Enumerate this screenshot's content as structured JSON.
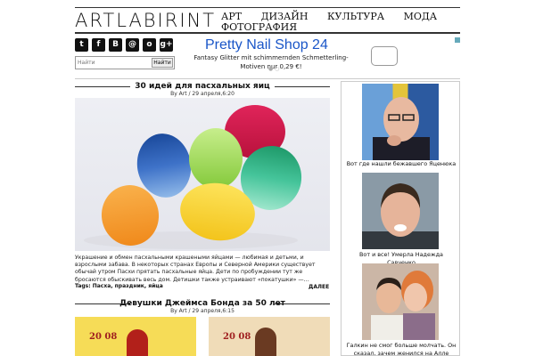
{
  "header": {
    "logo": "ARTLABIRINT"
  },
  "nav": [
    "АРТ",
    "ДИЗАЙН",
    "КУЛЬТУРА",
    "МОДА",
    "ФОТОГРАФИЯ"
  ],
  "social": [
    "twitter-icon",
    "facebook-icon",
    "vk-icon",
    "mail-icon",
    "odnoklassniki-icon",
    "google-plus-icon"
  ],
  "social_glyphs": [
    "t",
    "f",
    "В",
    "@",
    "o",
    "g+"
  ],
  "search": {
    "placeholder": "Найти",
    "button": "Найти"
  },
  "ad": {
    "title": "Pretty Nail Shop 24",
    "text": "Fantasy Glitter mit schimmernden Schmetterling-Motiven nur 0,29 €!"
  },
  "posts": [
    {
      "title": "30 идей для пасхальных яиц",
      "meta": "By Art / 29 апреля,6:20",
      "excerpt": "Украшение и обмен пасхальными крашеными яйцами — любимая и детьми, и взрослыми забава. В некоторых странах Европы и Северной Америки существует обычай утром Пасхи прятать пасхальные яйца. Дети по пробуждении тут же бросаются обыскивать весь дом. Детишки также устраивают «покатушки» —…",
      "tags": "Tags: Пасха, праздник, яйца",
      "more": "ДАЛЕЕ"
    },
    {
      "title": "Девушки Джеймса Бонда за 50 лет",
      "meta": "By Art / 29 апреля,6:15",
      "thumb_text": "20 08"
    }
  ],
  "sidebar": [
    {
      "caption": "Вот где нашли бежавшего Яценюка"
    },
    {
      "caption": "Вот и все! Умерла Надежда Савченко"
    },
    {
      "caption": "Галкин не смог больше молчать. Он сказал, зачем женился на Алле"
    }
  ],
  "colors": {
    "ad_title": "#1a56c8",
    "accent": "#111111"
  }
}
